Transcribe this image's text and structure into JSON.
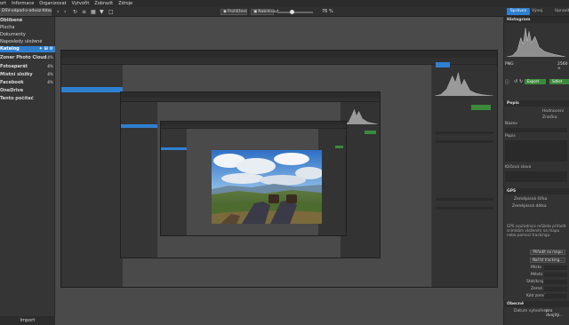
{
  "menu": [
    "ort",
    "Informace",
    "Organizovat",
    "Vytvořit",
    "Zobrazit",
    "Zdroje"
  ],
  "tab_title": "DSV-odpad-v-odvoz-fotografii-1...",
  "toolbar": {
    "view_label": "Prohlížení",
    "select_label": "Nabídnout",
    "zoom_value": "76 %"
  },
  "modes": {
    "manage": "Správce",
    "develop": "Vývoj",
    "edit": "Upravit"
  },
  "sidebar": {
    "items": [
      {
        "label": "Oblíbené",
        "bold": true,
        "selected": false,
        "badge": ""
      },
      {
        "label": "Plocha",
        "bold": false,
        "selected": false,
        "badge": ""
      },
      {
        "label": "Dokumenty",
        "bold": false,
        "selected": false,
        "badge": ""
      },
      {
        "label": "Naposledy uložené",
        "bold": false,
        "selected": false,
        "badge": ""
      },
      {
        "label": "Katalog",
        "bold": true,
        "selected": true,
        "badge": ""
      },
      {
        "label": "Zoner Photo Cloud",
        "bold": true,
        "selected": false,
        "badge": "4%"
      },
      {
        "label": "Fotoaparát",
        "bold": true,
        "selected": false,
        "badge": "4%"
      },
      {
        "label": "Místní složky",
        "bold": true,
        "selected": false,
        "badge": "4%"
      },
      {
        "label": "Facebook",
        "bold": true,
        "selected": false,
        "badge": "4%"
      },
      {
        "label": "OneDrive",
        "bold": true,
        "selected": false,
        "badge": ""
      },
      {
        "label": "Tento počítač",
        "bold": true,
        "selected": false,
        "badge": ""
      }
    ],
    "import_label": "Import"
  },
  "right_panel": {
    "histogram_title": "Histogram",
    "file_info": "PNG",
    "size_info": "2560 ×",
    "export_label": "Export",
    "share_label": "Sdílet",
    "description_title": "Popis",
    "rating_label": "Hodnocení",
    "label_label": "Značka",
    "name_label": "Název",
    "description_label": "Popis",
    "keywords_label": "Klíčová slova",
    "gps_title": "GPS",
    "gps_width_label": "Zeměpisná šířka",
    "gps_length_label": "Zeměpisná délka",
    "gps_note": "GPS souřadnice můžete přiřadit snímkům vložením na mapu nebo pomocí trackingu.",
    "gps_map_button": "Přiřadit na mapu",
    "gps_tracking_button": "Načíst tracking...",
    "place_labels": [
      "Místo",
      "Město",
      "Stát/kraj",
      "Země",
      "Kód země"
    ],
    "general_title": "Obecné",
    "created_label": "Datum vytvoření",
    "created_value": "pro dvojitý..."
  },
  "colors": {
    "accent": "#2f7fd1",
    "green": "#3b8a3b",
    "bg": "#3a3a3a"
  },
  "icons": {
    "view": "eye-icon",
    "select": "select-icon",
    "zoom": "zoom-slider",
    "hamburger": "menu-icon",
    "settings": "gear-icon"
  }
}
